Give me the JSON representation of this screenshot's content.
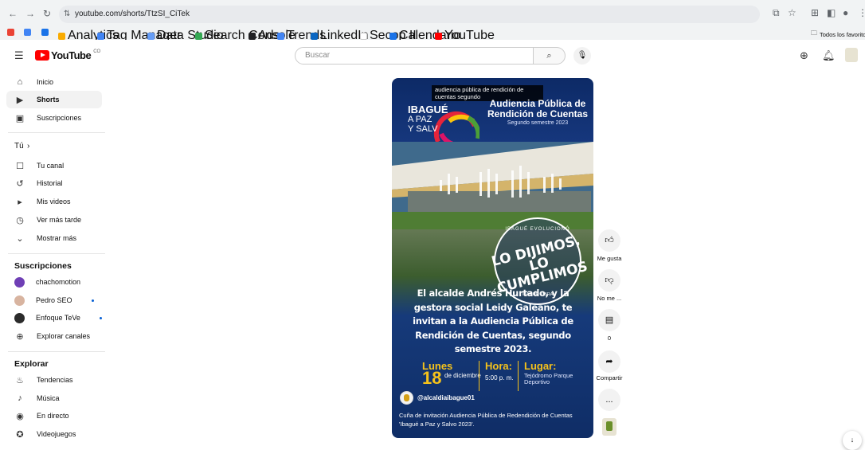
{
  "browser": {
    "url": "youtube.com/shorts/TtzSI_CiTek",
    "bookmarks": [
      {
        "label": "",
        "color": "#ea4335"
      },
      {
        "label": "",
        "color": "#4285f4"
      },
      {
        "label": "",
        "color": "#1a73e8"
      },
      {
        "label": "Analytics",
        "color": "#f9ab00"
      },
      {
        "label": "Tag Manager",
        "color": "#4285f4"
      },
      {
        "label": "Data Studio",
        "color": "#669df6"
      },
      {
        "label": "Search Console",
        "color": "#34a853"
      },
      {
        "label": "Ads",
        "color": "#202124"
      },
      {
        "label": "Trends",
        "color": "#4285f4"
      },
      {
        "label": "LinkedIn",
        "color": "#0a66c2"
      },
      {
        "label": "Secop II",
        "color": "#ffffff"
      },
      {
        "label": "Calendario",
        "color": "#1a73e8"
      },
      {
        "label": "YouTube",
        "color": "#ff0000"
      }
    ],
    "all_bookmarks": "Todos los favoritos"
  },
  "header": {
    "logo_text": "YouTube",
    "country_code": "CO",
    "search_placeholder": "Buscar"
  },
  "sidebar": {
    "main": [
      {
        "label": "Inicio",
        "icon": "home-icon",
        "glyph": "⌂"
      },
      {
        "label": "Shorts",
        "icon": "shorts-icon",
        "glyph": "▶"
      },
      {
        "label": "Suscripciones",
        "icon": "subscriptions-icon",
        "glyph": "▣"
      }
    ],
    "you_title": "Tú",
    "you": [
      {
        "label": "Tu canal",
        "icon": "channel-icon",
        "glyph": "☐"
      },
      {
        "label": "Historial",
        "icon": "history-icon",
        "glyph": "↺"
      },
      {
        "label": "Mis videos",
        "icon": "my-videos-icon",
        "glyph": "▸"
      },
      {
        "label": "Ver más tarde",
        "icon": "watch-later-icon",
        "glyph": "◷"
      },
      {
        "label": "Mostrar más",
        "icon": "chevron-down-icon",
        "glyph": "⌄"
      }
    ],
    "subs_title": "Suscripciones",
    "subs": [
      {
        "label": "chachomotion",
        "avatar_color": "#6f3fb5",
        "live": false
      },
      {
        "label": "Pedro SEO",
        "avatar_color": "#d8b4a0",
        "live": true
      },
      {
        "label": "Enfoque TeVe",
        "avatar_color": "#2b2b2b",
        "live": true
      },
      {
        "label": "Explorar canales",
        "avatar_color": "",
        "live": false
      }
    ],
    "explore_title": "Explorar",
    "explore": [
      {
        "label": "Tendencias",
        "icon": "trending-icon",
        "glyph": "♨"
      },
      {
        "label": "Música",
        "icon": "music-icon",
        "glyph": "♪"
      },
      {
        "label": "En directo",
        "icon": "live-icon",
        "glyph": "◉"
      },
      {
        "label": "Videojuegos",
        "icon": "gaming-icon",
        "glyph": "✪"
      }
    ]
  },
  "short": {
    "caption": "audiencia pública de rendición de cuentas segundo",
    "brand": "IBAGUÉ",
    "brand_sub1": "A PAZ",
    "brand_sub2": "Y SALV",
    "title": "Audiencia Pública de Rendición de Cuentas",
    "subtitle": "Segundo semestre 2023",
    "badge_top": "IBAGUÉ EVOLUCIONÓ",
    "badge_main": "LO DIJIMOS, LO CUMPLIMOS",
    "badge_bottom": "IBAGUÉ VIBRA",
    "invite": "El alcalde Andrés Hurtado, y la gestora social Leidy Galeano, te invitan a la Audiencia Pública de Rendición de Cuentas, segundo semestre 2023.",
    "day_label": "Lunes",
    "day_num": "18",
    "day_month": "de diciembre",
    "hour_label": "Hora:",
    "hour_value": "5:00 p. m.",
    "place_label": "Lugar:",
    "place_value": "Tejódromo Parque Deportivo",
    "channel": "@alcaldiaibague01",
    "video_title": "Cuña de invitación Audiencia Pública de Redendición de Cuentas 'Ibagué a Paz y Salvo 2023'."
  },
  "actions": {
    "like": "Me gusta",
    "dislike": "No me ...",
    "comments": "0",
    "share": "Compartir",
    "more": "..."
  }
}
